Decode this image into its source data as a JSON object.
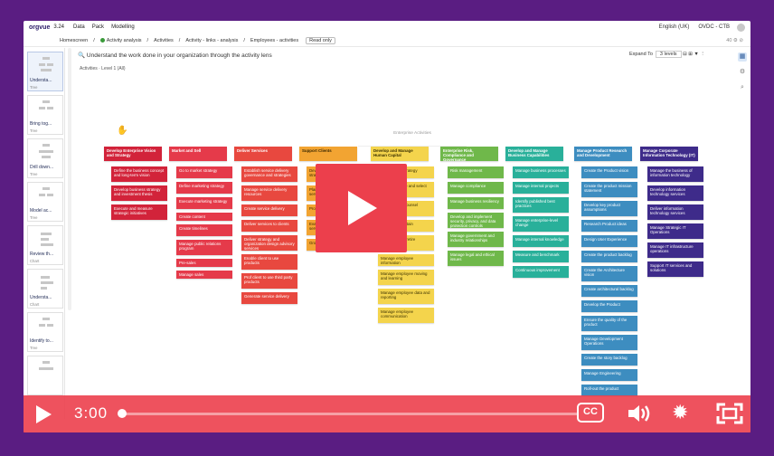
{
  "app": {
    "logo": "orgvue",
    "version": "3.24",
    "menu": [
      "Data",
      "Pack",
      "Modelling"
    ],
    "language": "English (UK)",
    "workspace": "OVDC - CTB"
  },
  "toolbar": {
    "home": "Homescreen",
    "separator": "/",
    "crumbs": [
      "Activity analysis",
      "Activities",
      "Activity - links - analysis",
      "Employees - activities"
    ],
    "readonly": "Read only",
    "right_icons": "40 ⚙ ⊘"
  },
  "canvas": {
    "question": "Understand the work done in your organization through the activity lens",
    "expand_label": "Expand To",
    "expand_value": "3 levels",
    "subhead": "Activities  ·  Level 1 (All)",
    "enterprise": "Enterprise Activities"
  },
  "sidebar": {
    "items": [
      {
        "label": "Understa...",
        "kind": "Tree"
      },
      {
        "label": "Bring tog...",
        "kind": "Tree"
      },
      {
        "label": "Drill down...",
        "kind": "Tree"
      },
      {
        "label": "Model ac...",
        "kind": "Tree"
      },
      {
        "label": "Review th...",
        "kind": "Chart"
      },
      {
        "label": "Understa...",
        "kind": "Chart"
      },
      {
        "label": "Identify to...",
        "kind": "Tree"
      },
      {
        "label": "",
        "kind": ""
      }
    ]
  },
  "columns": [
    {
      "color": "#d2233a",
      "text": "#ffffff",
      "head": "Develop Enterprise Vision and Strategy",
      "children": [
        "Define the business concept and long-term vision",
        "Develop business strategy and investment thesis",
        "Execute and measure strategic initiatives"
      ]
    },
    {
      "color": "#e53a4a",
      "text": "#ffffff",
      "head": "Market and Sell",
      "children": [
        "Go to market strategy",
        "Define marketing strategy",
        "Execute marketing strategy",
        "Create content",
        "Create timelines",
        "Manage public relations program",
        "Pre-sales",
        "Manage sales"
      ]
    },
    {
      "color": "#e8483f",
      "text": "#ffffff",
      "head": "Deliver Services",
      "children": [
        "Establish service delivery governance and strategies",
        "Manage service delivery resources",
        "Create service delivery",
        "Deliver services to clients",
        "Deliver strategy and organization design advisory services",
        "Enable client to use products",
        "Prof client to use third party products",
        "Generate service delivery"
      ]
    },
    {
      "color": "#f2a432",
      "text": "#3a2800",
      "head": "Support Clients",
      "children": [
        "Develop client service strategy",
        "Plan and manage client service contacts",
        "Provide client services",
        "Evaluate and improve client service operations",
        "Grow client service"
      ]
    },
    {
      "color": "#f4d44c",
      "text": "#3a3000",
      "head": "Develop and Manage Human Capital",
      "children": [
        "Develop HR strategy",
        "Recruit, source and select employees",
        "Develop and counsel employees",
        "Reward and retain employees",
        "Redeploy and retire employees",
        "Manage employee information",
        "Manage employee moving and learning",
        "Manage employee data and reporting",
        "Manage employee communication"
      ]
    },
    {
      "color": "#6fb84a",
      "text": "#ffffff",
      "head": "Enterprise Risk, Compliance and Governance",
      "children": [
        "Risk management",
        "Manage compliance",
        "Manage business resiliency",
        "Develop and implement security, privacy, and data protection controls",
        "Manage government and industry relationships",
        "Manage legal and ethical issues"
      ]
    },
    {
      "color": "#29b09a",
      "text": "#ffffff",
      "head": "Develop and Manage Business Capabilities",
      "children": [
        "Manage business processes",
        "Manage internal projects",
        "Identify published best practices",
        "Manage enterprise-level change",
        "Manage internal knowledge",
        "Measure and benchmark",
        "Continuous improvement"
      ]
    },
    {
      "color": "#3d8dc0",
      "text": "#ffffff",
      "head": "Manage Product Research and Development",
      "children": [
        "Create the Product vision",
        "Create the product mission statement",
        "Develop key product assumptions",
        "Research Product ideas",
        "Design User Experience",
        "Create the product backlog",
        "Create the Architecture vision",
        "Create architectural backlog",
        "Develop the Product",
        "Ensure the quality of the product",
        "Manage Development Operations",
        "Create the story backlog",
        "Manage Engineering",
        "Roll-out the product"
      ]
    },
    {
      "color": "#3e2b8a",
      "text": "#ffffff",
      "head": "Manage Corporate Information Technology (IT)",
      "children": [
        "Manage the business of information technology",
        "Develop information technology services",
        "Deliver information technology services",
        "Manage Strategic IT Operations",
        "Manage IT infrastructure operations",
        "Support IT services and solutions"
      ]
    }
  ],
  "player": {
    "time": "3:00",
    "cc": "CC",
    "progress": 0.0
  }
}
